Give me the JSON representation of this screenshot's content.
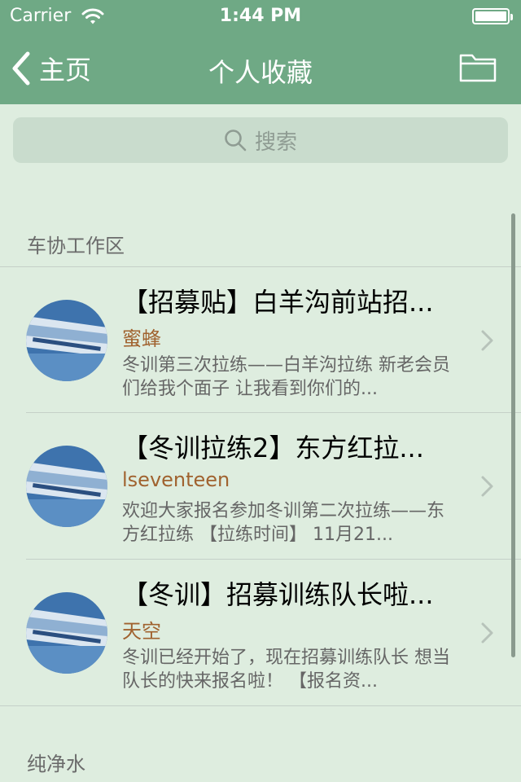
{
  "status_bar": {
    "carrier": "Carrier",
    "time": "1:44 PM"
  },
  "nav": {
    "back_label": "主页",
    "title": "个人收藏"
  },
  "search": {
    "placeholder": "搜索"
  },
  "sections": [
    {
      "header": "车协工作区",
      "items": [
        {
          "title": "【招募贴】白羊沟前站招...",
          "author": "蜜蜂",
          "desc": "冬训第三次拉练——白羊沟拉练 新老会员们给我个面子 让我看到你们的..."
        },
        {
          "title": "【冬训拉练2】东方红拉...",
          "author": "lseventeen",
          "desc": "欢迎大家报名参加冬训第二次拉练——东方红拉练 【拉练时间】 11月21..."
        },
        {
          "title": "【冬训】招募训练队长啦...",
          "author": "天空",
          "desc": "冬训已经开始了，现在招募训练队长 想当队长的快来报名啦！ 【报名资..."
        }
      ]
    },
    {
      "header": "纯净水",
      "items": []
    }
  ],
  "colors": {
    "nav_bar": "#6fa985",
    "background": "#deeddf",
    "author": "#a0622f"
  },
  "icons": [
    "wifi-icon",
    "battery-icon",
    "back-chevron-icon",
    "folder-icon",
    "search-icon",
    "chevron-right-icon"
  ]
}
